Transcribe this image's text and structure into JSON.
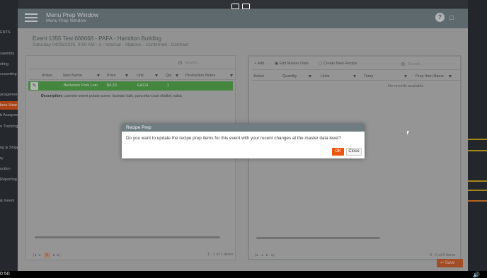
{
  "sidebar": {
    "items": [
      {
        "label": "ENTS",
        "active": false
      },
      {
        "label": "ssembly",
        "active": false
      },
      {
        "label": "eting",
        "active": false
      },
      {
        "label": "ccounting",
        "active": false
      },
      {
        "label": "anagement",
        "active": false
      },
      {
        "label": "lenu View",
        "active": true
      },
      {
        "label": "b Assignm",
        "active": false
      },
      {
        "label": "n Tracking",
        "active": false
      },
      {
        "label": "ng & Shipp",
        "active": false
      },
      {
        "label": "ry",
        "active": false
      },
      {
        "label": "uction",
        "active": false
      },
      {
        "label": "Reporting",
        "active": false
      },
      {
        "label": "& Invent",
        "active": false
      }
    ]
  },
  "window": {
    "title": "Menu Prep Window",
    "subtitle": "Menu Prep Window",
    "help_icon": "?"
  },
  "event": {
    "title": "Event 1355 Test 666666 - PAFA - Hamilton Building",
    "details": "Saturday 04/26/2025, 9:00 AM - 1 - Internal - Stations - Confirmed - Contract"
  },
  "left_grid": {
    "search_placeholder": "Search...",
    "columns": [
      "Action",
      "Item Name",
      "Price",
      "Unit",
      "Qty",
      "Production Notes"
    ],
    "rows": [
      {
        "item_name": "Berkshire Pork Loin",
        "price": "$4.20",
        "unit": "EACH",
        "qty": "1",
        "notes": ""
      }
    ],
    "description_label": "Description:",
    "description_text": "cannelo-sweet potato puree, lacinato kale, pancetta-crust shallot, salsa",
    "pager_page": "1",
    "pager_info": "1 - 1 of 1 items"
  },
  "right_grid": {
    "toolbar": {
      "add": "Add",
      "edit_master": "Edit Master Data",
      "create_recipe": "Create New Recipe"
    },
    "search_placeholder": "Search...",
    "columns": [
      "Action",
      "Quantity",
      "Units",
      "Temp",
      "Prep Item Name"
    ],
    "empty_text": "No records available.",
    "pager_info": "0 - 0 of 0 items"
  },
  "footer": {
    "save_label": "Save"
  },
  "dialog": {
    "title": "Recipe Prep",
    "message": "Do you want to update the recipe prep items for this event with your recent changes at the master data level?",
    "ok_label": "OK",
    "close_label": "Close"
  },
  "player": {
    "time": "0:50"
  },
  "colors": {
    "accent": "#e9560c",
    "header": "#738086",
    "selected_row": "#55a44e"
  }
}
